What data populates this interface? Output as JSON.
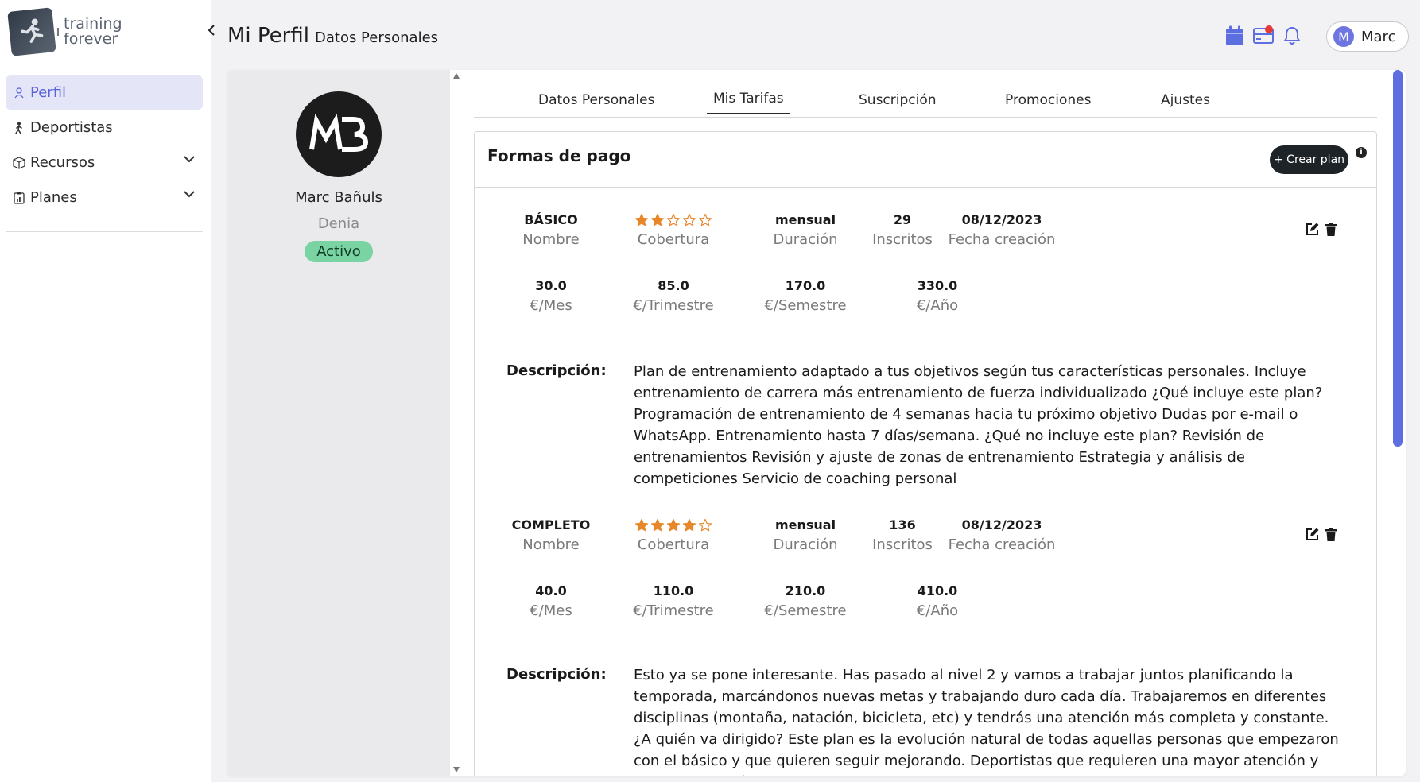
{
  "brand": {
    "line1": "training",
    "line2": "forever"
  },
  "sidebar": {
    "items": [
      {
        "label": "Perfil",
        "active": true
      },
      {
        "label": "Deportistas"
      },
      {
        "label": "Recursos",
        "expandable": true
      },
      {
        "label": "Planes",
        "expandable": true
      }
    ]
  },
  "header": {
    "title": "Mi Perfil",
    "subtitle": "Datos Personales",
    "user_initial": "M",
    "user_name": "Marc"
  },
  "profile": {
    "initials_logo": "MB",
    "name": "Marc Bañuls",
    "city": "Denia",
    "status": "Activo"
  },
  "tabs": [
    "Datos Personales",
    "Mis Tarifas",
    "Suscripción",
    "Promociones",
    "Ajustes"
  ],
  "active_tab": "Mis Tarifas",
  "payment": {
    "title": "Formas de pago",
    "create_label": "+ Crear plan",
    "info": "i"
  },
  "labels": {
    "nombre": "Nombre",
    "cobertura": "Cobertura",
    "duracion": "Duración",
    "inscritos": "Inscritos",
    "fecha": "Fecha creación",
    "mes": "€/Mes",
    "trimestre": "€/Trimestre",
    "semestre": "€/Semestre",
    "anio": "€/Año",
    "descripcion": "Descripción:"
  },
  "plans": [
    {
      "name": "BÁSICO",
      "stars": 2,
      "max_stars": 5,
      "duration": "mensual",
      "enrolled": "29",
      "created": "08/12/2023",
      "price_month": "30.0",
      "price_quarter": "85.0",
      "price_semester": "170.0",
      "price_year": "330.0",
      "description": "Plan de entrenamiento adaptado a tus objetivos según tus características personales. Incluye entrenamiento de carrera más entrenamiento de fuerza individualizado ¿Qué incluye este plan? Programación de entrenamiento de 4 semanas hacia tu próximo objetivo Dudas por e-mail o WhatsApp. Entrenamiento hasta 7 días/semana. ¿Qué no incluye este plan? Revisión de entrenamientos Revisión y ajuste de zonas de entrenamiento Estrategia y análisis de competiciones Servicio de coaching personal"
    },
    {
      "name": "COMPLETO",
      "stars": 4,
      "max_stars": 5,
      "duration": "mensual",
      "enrolled": "136",
      "created": "08/12/2023",
      "price_month": "40.0",
      "price_quarter": "110.0",
      "price_semester": "210.0",
      "price_year": "410.0",
      "description": "Esto ya se pone interesante. Has pasado al nivel 2 y vamos a trabajar juntos planificando la temporada, marcándonos nuevas metas y trabajando duro cada día. Trabajaremos en diferentes disciplinas (montaña, natación, bicicleta, etc) y tendrás una atención más completa y constante. ¿A quién va dirigido? Este plan es la evolución natural de todas aquellas personas que empezaron con el básico y que quieren seguir mejorando. Deportistas que requieren una mayor atención y una planificación a medio/largo plazo para"
    }
  ],
  "colors": {
    "accent": "#5a63d8",
    "star": "#e8862a",
    "status": "#7ad3a2",
    "scroll": "#5c6ee0",
    "notification": "#e53935"
  },
  "icons": [
    "calendar-icon",
    "credit-card-icon",
    "bell-icon",
    "edit-icon",
    "trash-icon",
    "user-icon",
    "walking-icon",
    "box-icon",
    "clipboard-icon",
    "chevron-down-icon",
    "chevron-left-icon"
  ]
}
